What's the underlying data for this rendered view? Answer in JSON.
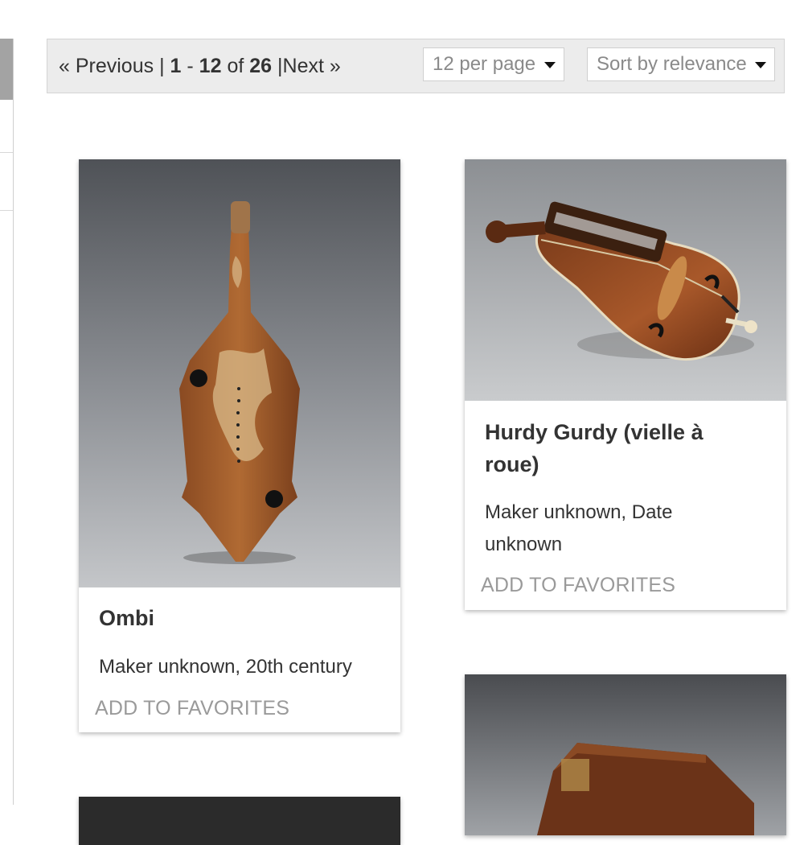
{
  "pagination": {
    "previous_label": "« Previous",
    "separator": "|",
    "range_start": "1",
    "range_dash": "-",
    "range_end": "12",
    "of_label": "of",
    "total": "26",
    "next_label": "Next »"
  },
  "per_page": {
    "selected": "12 per page"
  },
  "sort": {
    "selected": "Sort by relevance"
  },
  "results": [
    {
      "title": "Ombi",
      "meta": "Maker unknown, 20th century",
      "favorite_label": "ADD TO FAVORITES"
    },
    {
      "title": "Hurdy Gurdy (vielle à roue)",
      "meta": "Maker unknown, Date unknown",
      "favorite_label": "ADD TO FAVORITES"
    }
  ],
  "icons": {
    "caret": "caret-down-icon"
  }
}
